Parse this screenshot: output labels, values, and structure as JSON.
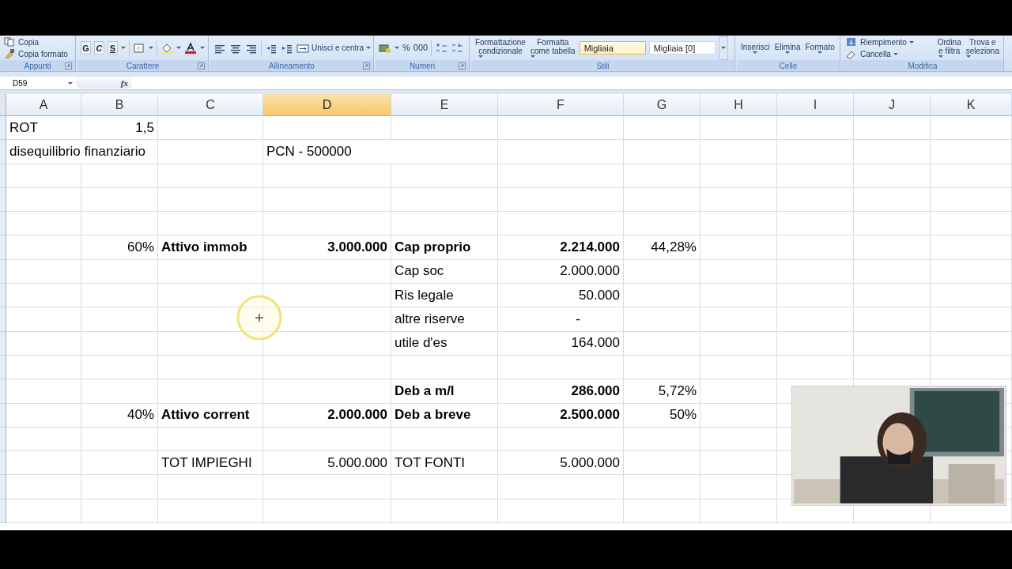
{
  "ribbon": {
    "groups": [
      {
        "label": "Appunti",
        "items": [
          "Copia",
          "Copia formato"
        ]
      },
      {
        "label": "Carattere",
        "buttons": [
          "G",
          "C",
          "S"
        ]
      },
      {
        "label": "Allineamento",
        "merge": "Unisci e centra"
      },
      {
        "label": "Numeri",
        "buttons": [
          "%",
          "000"
        ]
      },
      {
        "label": "Stili",
        "commands": [
          {
            "lines": [
              "Formattazione",
              "condizionale"
            ]
          },
          {
            "lines": [
              "Formatta",
              "come tabella"
            ]
          }
        ],
        "styles": [
          {
            "label": "Migliaia",
            "selected": true
          },
          {
            "label": "Migliaia [0]",
            "selected": false
          }
        ]
      },
      {
        "label": "Celle",
        "commands": [
          {
            "lines": [
              "Inserisci"
            ]
          },
          {
            "lines": [
              "Elimina"
            ]
          },
          {
            "lines": [
              "Formato"
            ]
          }
        ]
      },
      {
        "label": "Modifica",
        "items": [
          "Riempimento",
          "Cancella"
        ],
        "commands": [
          {
            "lines": [
              "Ordina",
              "e filtra"
            ]
          },
          {
            "lines": [
              "Trova e",
              "seleziona"
            ]
          }
        ]
      }
    ]
  },
  "formula_bar": {
    "name_box": "D59",
    "function_label": "fx"
  },
  "columns": [
    {
      "label": "A",
      "selected": false
    },
    {
      "label": "B",
      "selected": false
    },
    {
      "label": "C",
      "selected": false
    },
    {
      "label": "D",
      "selected": true
    },
    {
      "label": "E",
      "selected": false
    },
    {
      "label": "F",
      "selected": false
    },
    {
      "label": "G",
      "selected": false
    },
    {
      "label": "H",
      "selected": false
    },
    {
      "label": "I",
      "selected": false
    },
    {
      "label": "J",
      "selected": false
    },
    {
      "label": "K",
      "selected": false
    }
  ],
  "rows": [
    {
      "A": {
        "text": "ROT",
        "bold": false
      },
      "B": {
        "text": "1,5",
        "kind": "number",
        "bold": false
      }
    },
    {
      "A": {
        "text": "disequilibrio finanziario",
        "bold": false
      },
      "D": {
        "text": "PCN - 500000",
        "bold": false
      }
    },
    {},
    {},
    {},
    {
      "B": {
        "text": "60%",
        "kind": "number",
        "bold": false
      },
      "C": {
        "text": "Attivo immob",
        "bold": true
      },
      "D": {
        "text": "3.000.000",
        "kind": "number",
        "bold": true
      },
      "E": {
        "text": "Cap proprio",
        "bold": true
      },
      "F": {
        "text": "2.214.000",
        "kind": "number",
        "bold": true
      },
      "G": {
        "text": "44,28%",
        "kind": "number",
        "bold": false
      }
    },
    {
      "E": {
        "text": "Cap soc",
        "bold": false
      },
      "F": {
        "text": "2.000.000",
        "kind": "number",
        "bold": false
      }
    },
    {
      "E": {
        "text": "Ris legale",
        "bold": false
      },
      "F": {
        "text": "50.000",
        "kind": "number",
        "bold": false
      }
    },
    {
      "E": {
        "text": "altre riserve",
        "bold": false
      },
      "F": {
        "text": "-",
        "kind": "dash",
        "bold": false
      }
    },
    {
      "E": {
        "text": "utile d'es",
        "bold": false
      },
      "F": {
        "text": "164.000",
        "kind": "number",
        "bold": false
      }
    },
    {},
    {
      "E": {
        "text": "Deb a m/l",
        "bold": true
      },
      "F": {
        "text": "286.000",
        "kind": "number",
        "bold": true
      },
      "G": {
        "text": "5,72%",
        "kind": "number",
        "bold": false
      }
    },
    {
      "B": {
        "text": "40%",
        "kind": "number",
        "bold": false
      },
      "C": {
        "text": "Attivo corrent",
        "bold": true
      },
      "D": {
        "text": "2.000.000",
        "kind": "number",
        "bold": true
      },
      "E": {
        "text": "Deb a breve",
        "bold": true
      },
      "F": {
        "text": "2.500.000",
        "kind": "number",
        "bold": true
      },
      "G": {
        "text": "50%",
        "kind": "number",
        "bold": false
      }
    },
    {},
    {
      "C": {
        "text": "TOT IMPIEGHI",
        "bold": false
      },
      "D": {
        "text": "5.000.000",
        "kind": "number",
        "bold": false
      },
      "E": {
        "text": "TOT FONTI",
        "bold": false
      },
      "F": {
        "text": "5.000.000",
        "kind": "number",
        "bold": false
      }
    },
    {},
    {}
  ]
}
